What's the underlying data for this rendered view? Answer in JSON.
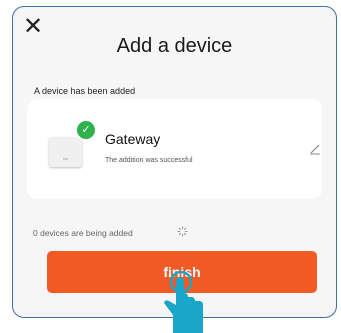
{
  "header": {
    "title": "Add a device",
    "close_icon": "close-icon"
  },
  "section": {
    "label": "A device has been added"
  },
  "device": {
    "name": "Gateway",
    "status": "The addition was successful",
    "status_icon": "check-circle-icon",
    "edit_icon": "edit-pencil-icon"
  },
  "progress": {
    "text": "0 devices are being added",
    "icon": "loading-spinner-icon"
  },
  "actions": {
    "finish_label": "finish"
  },
  "colors": {
    "accent": "#f15a24",
    "success": "#2fb24c",
    "hand": "#1aa6c8"
  }
}
